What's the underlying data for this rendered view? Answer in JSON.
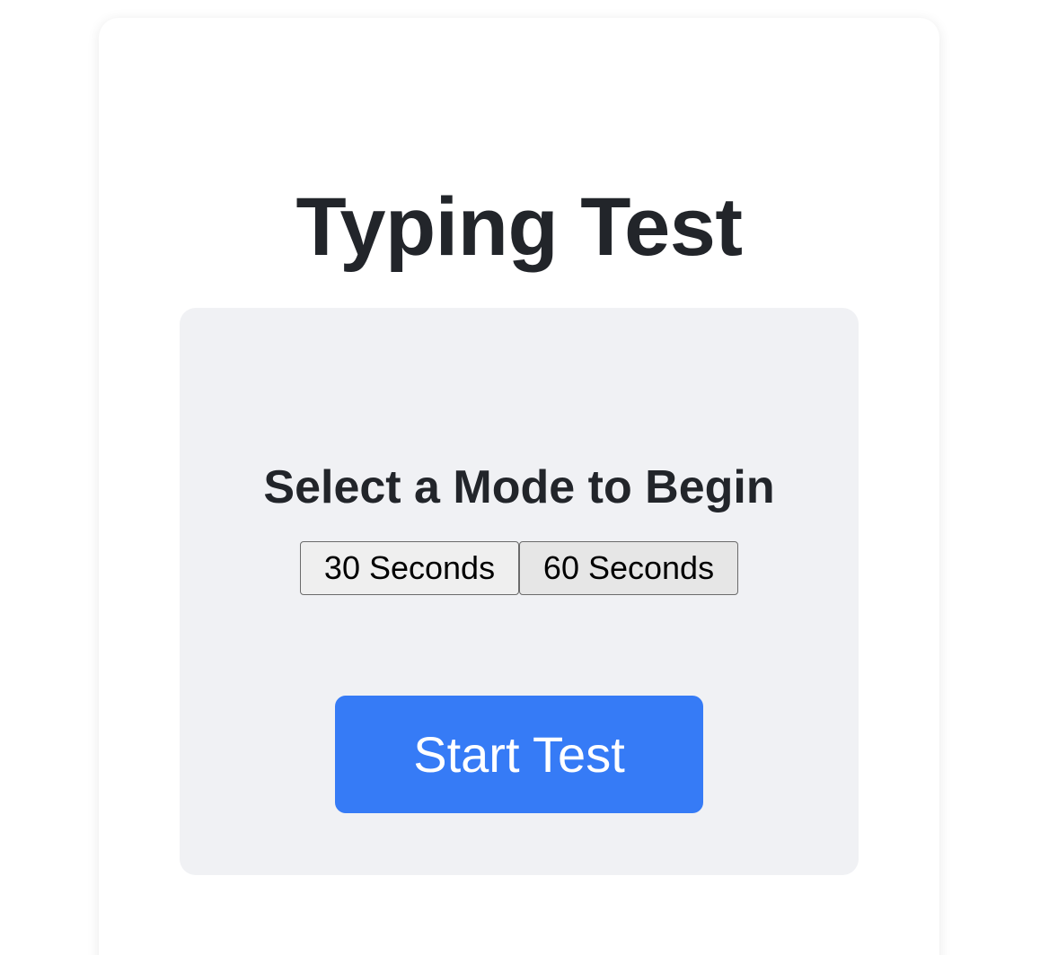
{
  "app": {
    "title": "Typing Test"
  },
  "panel": {
    "heading": "Select a Mode to Begin",
    "modes": [
      {
        "label": "30 Seconds"
      },
      {
        "label": "60 Seconds"
      }
    ],
    "start_label": "Start Test"
  },
  "colors": {
    "accent": "#367bf6",
    "panel_bg": "#f0f1f4",
    "text": "#22252a"
  }
}
